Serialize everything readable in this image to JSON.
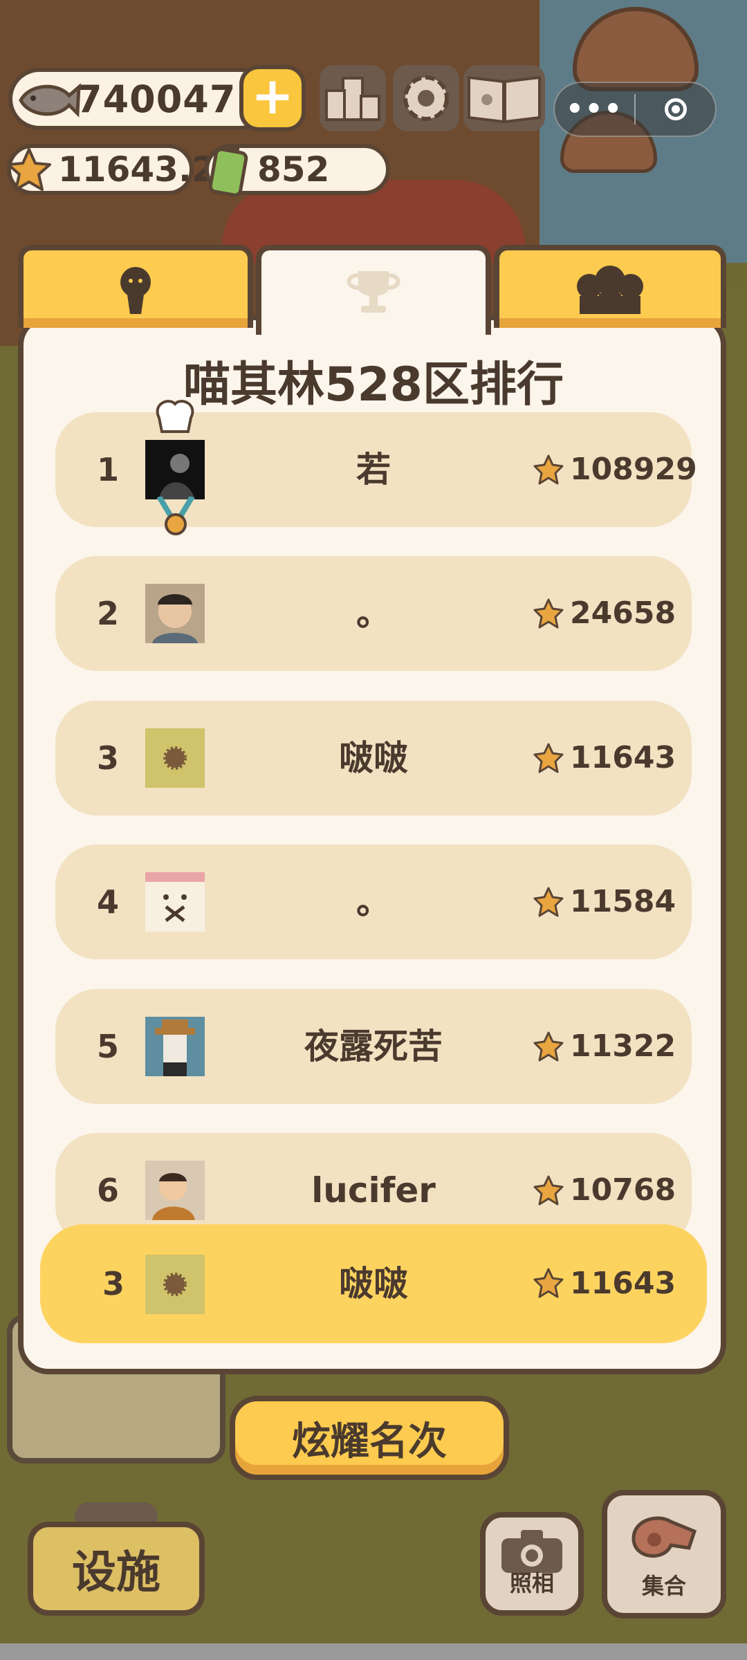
{
  "currencies": {
    "fish": "740047",
    "stars": "11643.2",
    "battery": "852"
  },
  "leaderboard": {
    "title": "喵其林528区排行",
    "rows": [
      {
        "rank": "1",
        "name": "若",
        "score": "108929",
        "avatar": "dark-portrait"
      },
      {
        "rank": "2",
        "name": "。",
        "score": "24658",
        "avatar": "smiling-person"
      },
      {
        "rank": "3",
        "name": "啵啵",
        "score": "11643",
        "avatar": "khaki-urchin"
      },
      {
        "rank": "4",
        "name": "。",
        "score": "11584",
        "avatar": "cartoon-cat"
      },
      {
        "rank": "5",
        "name": "夜露死苦",
        "score": "11322",
        "avatar": "pixel-cowboy"
      },
      {
        "rank": "6",
        "name": "lucifer",
        "score": "10768",
        "avatar": "child-photo"
      }
    ],
    "my_row": {
      "rank": "3",
      "name": "啵啵",
      "score": "11643",
      "avatar": "khaki-urchin"
    }
  },
  "buttons": {
    "show_rank": "炫耀名次",
    "facilities": "设施",
    "photo": "照相",
    "assemble": "集合"
  },
  "mini_program": {
    "more": "•••"
  },
  "colors": {
    "panel_bg": "#fcf5ec",
    "row_bg": "#f2e2c2",
    "highlight": "#fdd360",
    "tab_yellow": "#fccb4f",
    "outline": "#5a4535",
    "text": "#4a3a2e"
  }
}
